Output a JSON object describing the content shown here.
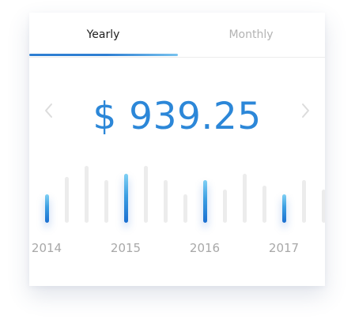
{
  "tabs": {
    "yearly_label": "Yearly",
    "monthly_label": "Monthly",
    "active": "Yearly"
  },
  "amount": "$ 939.25",
  "colors": {
    "accent": "#2c87d8",
    "bar_inactive": "#ececec",
    "bar_active_top": "#80d0f4",
    "bar_active_bottom": "#1b6fd0",
    "label": "#a8a8a8"
  },
  "icons": {
    "prev": "chevron-left-icon",
    "next": "chevron-right-icon"
  },
  "chart": {
    "year_labels": [
      "2014",
      "2015",
      "2016",
      "2017"
    ],
    "bars": [
      {
        "level": 0.47,
        "active": true
      },
      {
        "level": 0.76,
        "active": false
      },
      {
        "level": 0.95,
        "active": false
      },
      {
        "level": 0.71,
        "active": false
      },
      {
        "level": 0.81,
        "active": true
      },
      {
        "level": 0.95,
        "active": false
      },
      {
        "level": 0.71,
        "active": false
      },
      {
        "level": 0.48,
        "active": false
      },
      {
        "level": 0.71,
        "active": true
      },
      {
        "level": 0.55,
        "active": false
      },
      {
        "level": 0.81,
        "active": false
      },
      {
        "level": 0.62,
        "active": false
      },
      {
        "level": 0.48,
        "active": true
      },
      {
        "level": 0.71,
        "active": false
      },
      {
        "level": 0.55,
        "active": false
      }
    ]
  }
}
